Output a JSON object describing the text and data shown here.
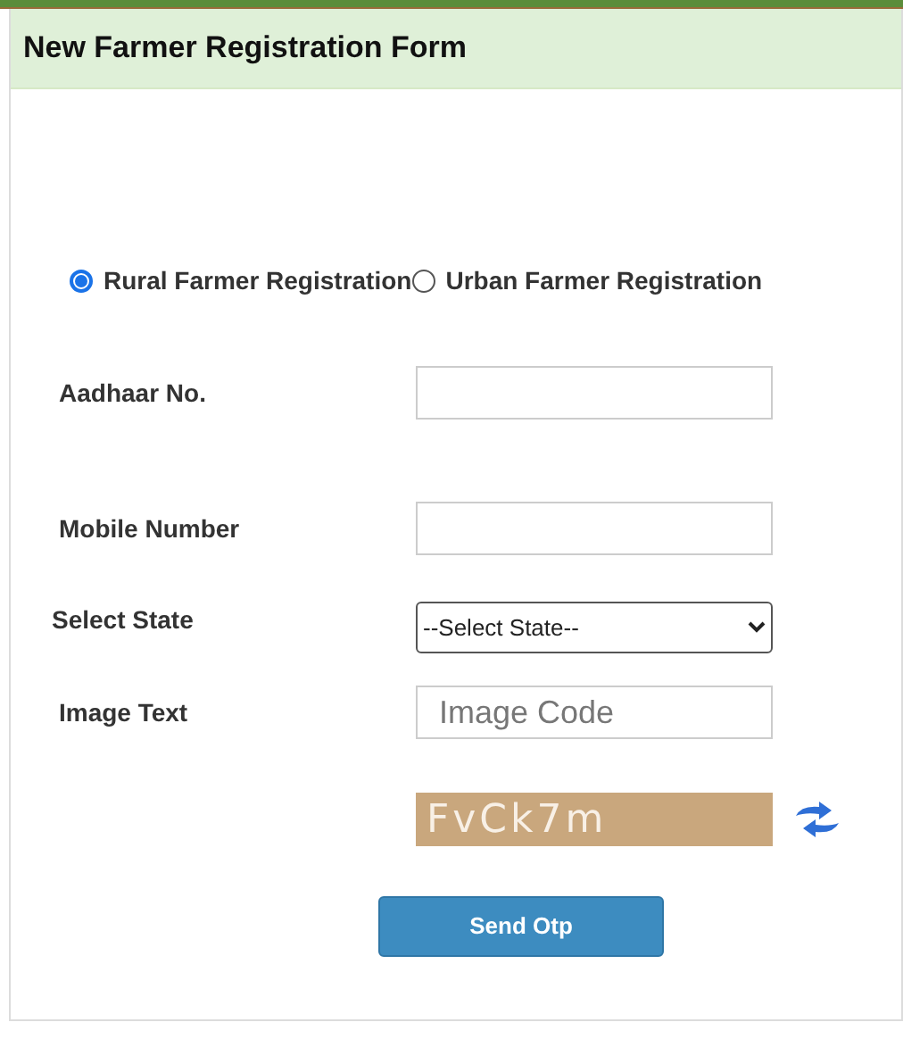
{
  "form": {
    "title": "New Farmer Registration Form"
  },
  "registration_types": [
    {
      "label": "Rural Farmer Registration",
      "selected": true
    },
    {
      "label": "Urban Farmer Registration",
      "selected": false
    }
  ],
  "fields": [
    {
      "kind": "text",
      "label": "Aadhaar No."
    },
    {
      "kind": "text",
      "label": "Mobile Number"
    },
    {
      "kind": "select",
      "label": "Select State",
      "value": "--Select State--"
    },
    {
      "kind": "text",
      "label": "Image Text",
      "placeholder": "Image Code"
    }
  ],
  "captcha": {
    "text": "FvCk7m"
  },
  "submit_button": {
    "label": "Send Otp"
  }
}
